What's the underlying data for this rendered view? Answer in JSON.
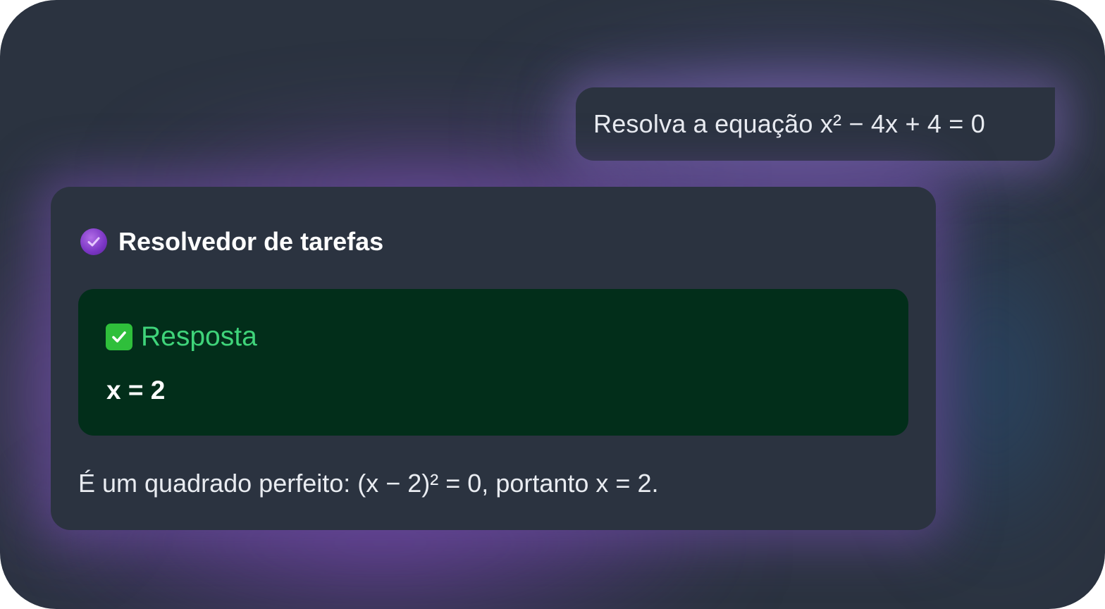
{
  "chat": {
    "user_message": "Resolva a equação x² − 4x + 4 = 0",
    "assistant": {
      "icon": "purple-check-badge-icon",
      "title": "Resolvedor de tarefas",
      "answer": {
        "icon": "green-checkmark-icon",
        "label": "Resposta",
        "value": "x = 2"
      },
      "explanation": "É um quadrado perfeito: (x − 2)² = 0, portanto x = 2."
    }
  },
  "colors": {
    "background": "#2b3340",
    "accent_purple": "#7a35c4",
    "answer_box": "#022e1a",
    "answer_label": "#3fd47a",
    "check_green": "#2fbf3b",
    "text": "#e9ecf1"
  }
}
